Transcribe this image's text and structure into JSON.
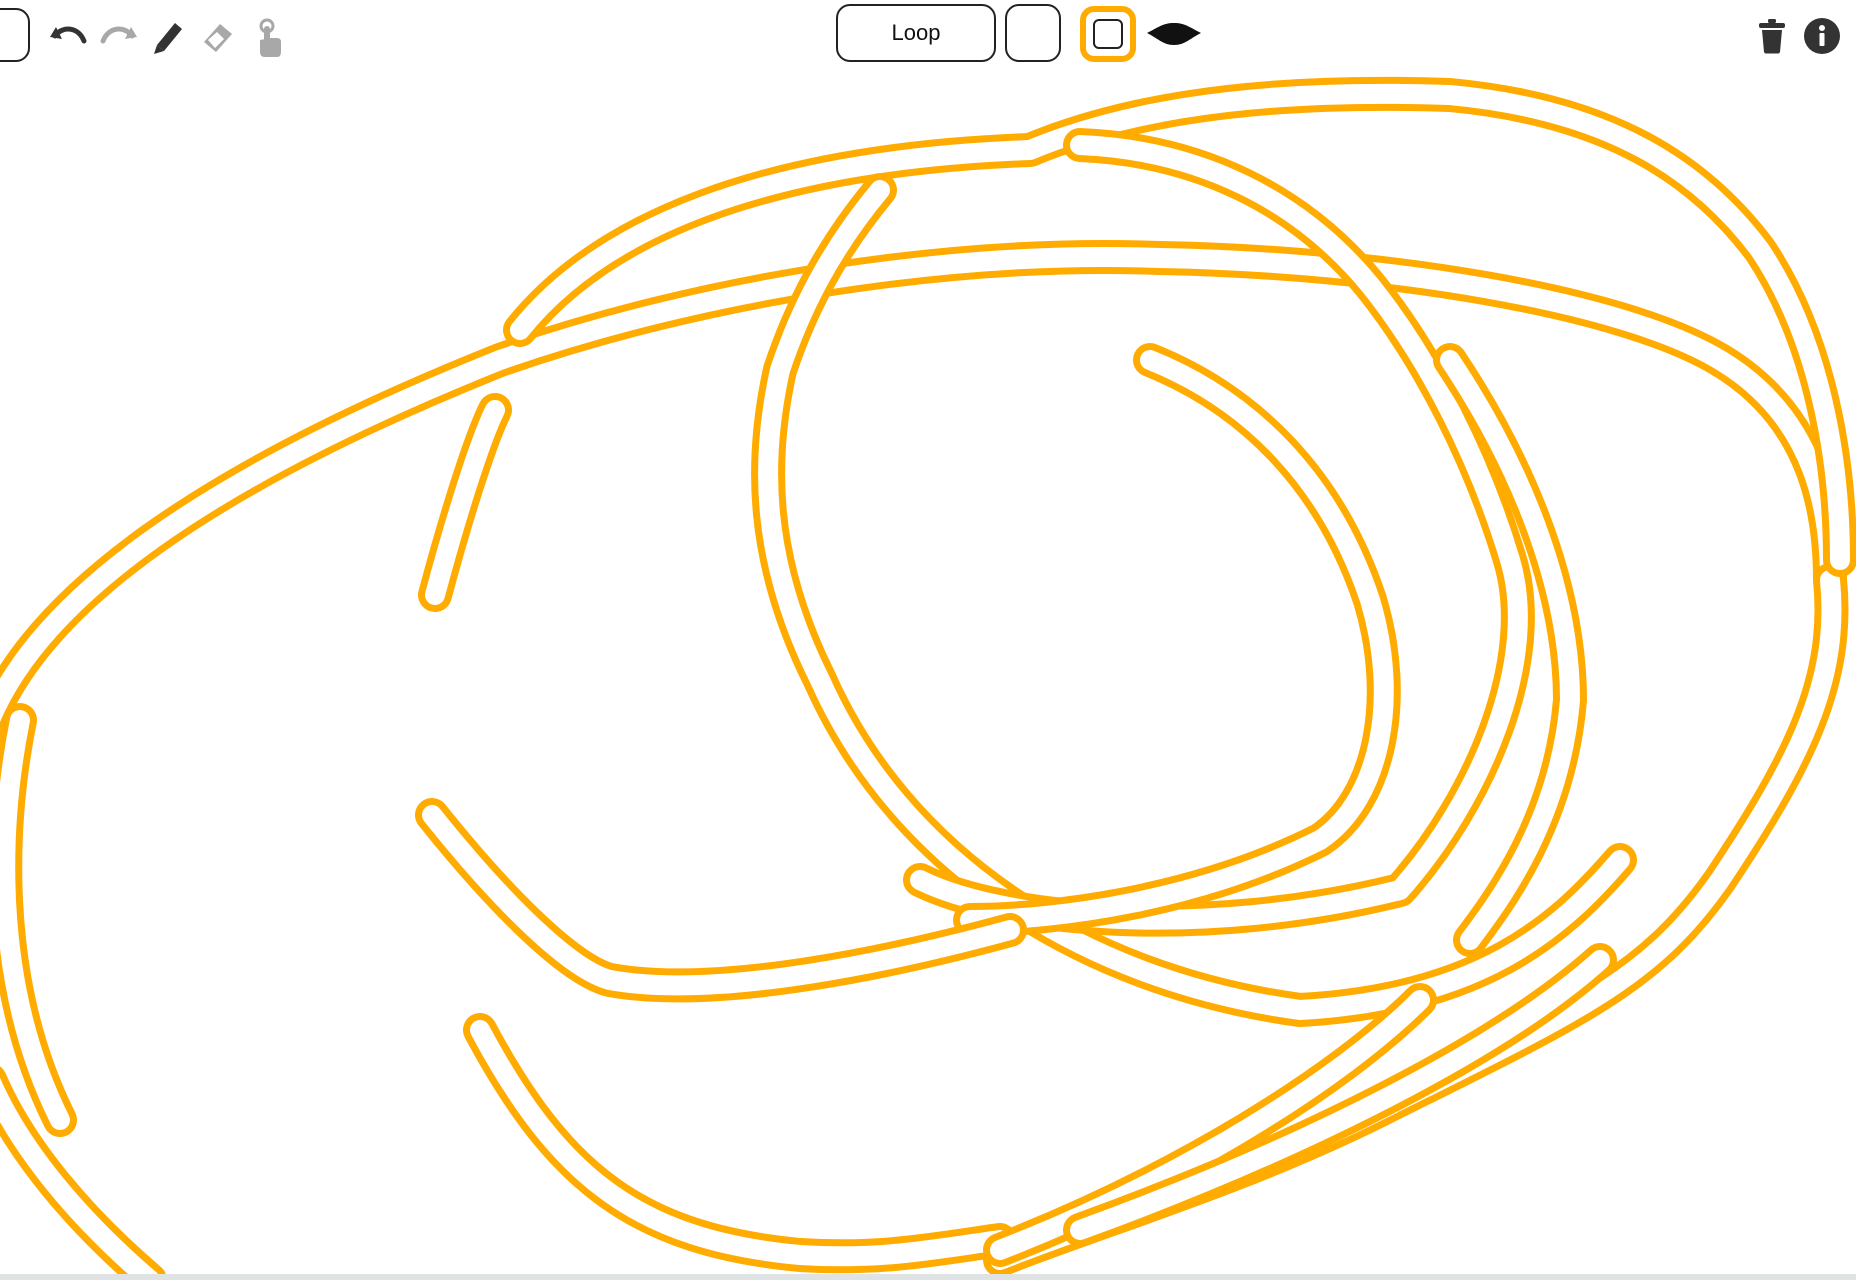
{
  "toolbar": {
    "color_swatch_icon": "color-swatch-icon",
    "undo_icon": "undo-icon",
    "redo_icon": "redo-icon",
    "pen_icon": "pen-icon",
    "eraser_icon": "eraser-icon",
    "touch_icon": "touch-icon",
    "mode_label": "Loop",
    "fill_icon": "fill-square-icon",
    "stroke_icon": "stroke-square-icon",
    "brush_icon": "brush-shape-icon",
    "trash_icon": "trash-icon",
    "info_icon": "info-icon"
  },
  "colors": {
    "accent": "#FFAB00",
    "icon_dark": "#333333",
    "icon_disabled": "#A8A8A8",
    "background": "#FFFFFF"
  },
  "canvas": {
    "stroke_color": "#FFAB00",
    "description_only": ""
  }
}
